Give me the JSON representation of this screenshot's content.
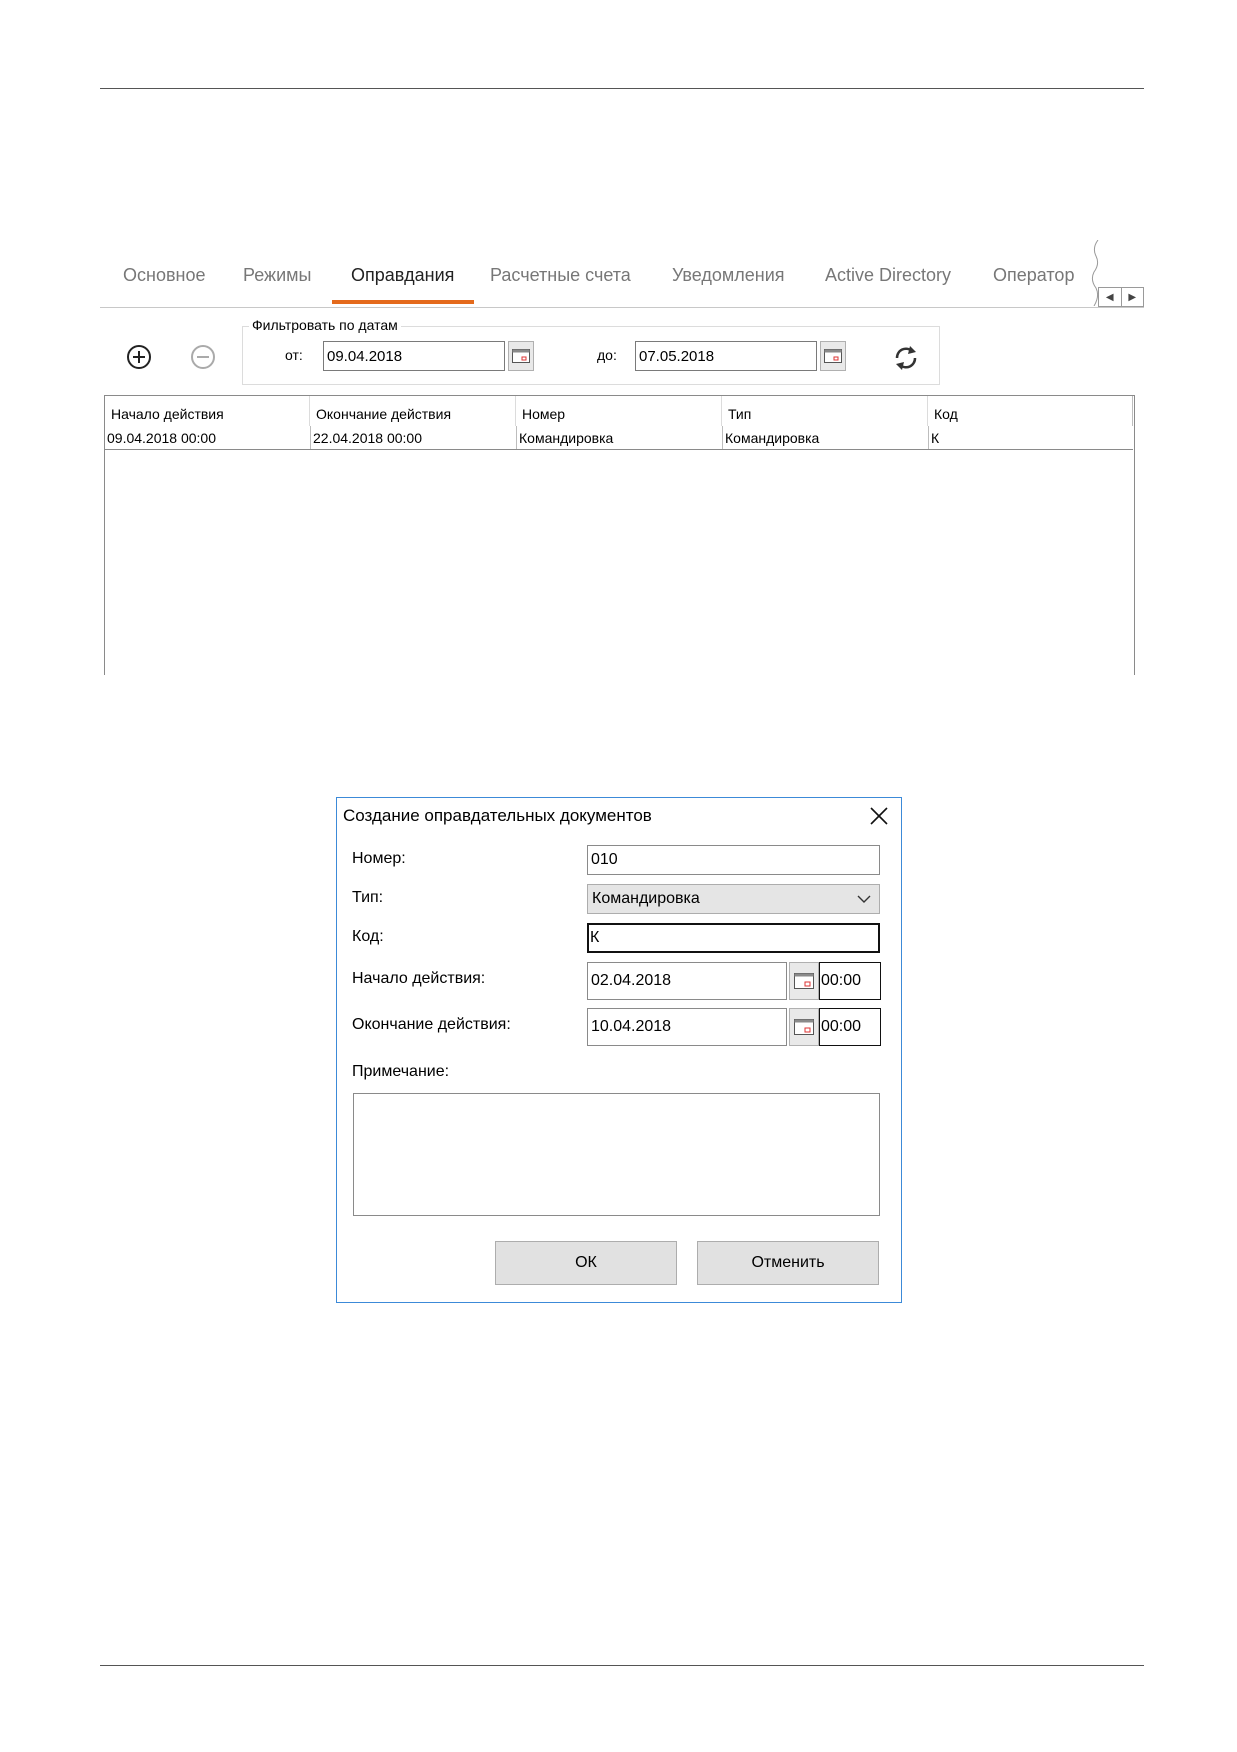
{
  "tabs": [
    {
      "label": "Основное"
    },
    {
      "label": "Режимы"
    },
    {
      "label": "Оправдания"
    },
    {
      "label": "Расчетные счета"
    },
    {
      "label": "Уведомления"
    },
    {
      "label": "Active Directory"
    },
    {
      "label": "Оператор"
    }
  ],
  "active_tab": "Оправдания",
  "accent_color": "#e46a1c",
  "toolbar": {
    "add_icon": "plus-circle-icon",
    "remove_icon": "minus-circle-icon",
    "refresh_icon": "refresh-icon"
  },
  "filter": {
    "legend": "Фильтровать по датам",
    "from_label": "от:",
    "from_value": "09.04.2018",
    "to_label": "до:",
    "to_value": "07.05.2018"
  },
  "table": {
    "columns": [
      "Начало действия",
      "Окончание действия",
      "Номер",
      "Тип",
      "Код"
    ],
    "rows": [
      [
        "09.04.2018 00:00",
        "22.04.2018 00:00",
        "Командировка",
        "Командировка",
        "К"
      ]
    ]
  },
  "dialog": {
    "title": "Создание оправдательных документов",
    "number_label": "Номер:",
    "number_value": "010",
    "type_label": "Тип:",
    "type_value": "Командировка",
    "code_label": "Код:",
    "code_value": "К",
    "start_label": "Начало действия:",
    "start_date": "02.04.2018",
    "start_time": "00:00",
    "end_label": "Окончание действия:",
    "end_date": "10.04.2018",
    "end_time": "00:00",
    "note_label": "Примечание:",
    "note_value": "",
    "ok_label": "ОК",
    "cancel_label": "Отменить"
  }
}
